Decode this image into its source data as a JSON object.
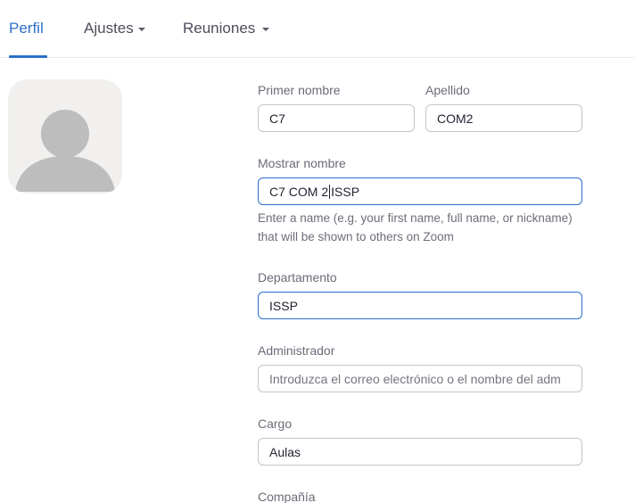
{
  "tabs": [
    {
      "label": "Perfil",
      "active": true
    },
    {
      "label": "Ajustes",
      "dropdown": true
    },
    {
      "label": "Reuniones",
      "dropdown": true
    }
  ],
  "avatar": {
    "icon": "user-placeholder-icon"
  },
  "form": {
    "first_name": {
      "label": "Primer nombre",
      "value": "C7"
    },
    "last_name": {
      "label": "Apellido",
      "value": "COM2"
    },
    "display_name": {
      "label": "Mostrar nombre",
      "value_before_cursor": "C7 COM 2",
      "value_after_cursor": "ISSP",
      "help": "Enter a name (e.g. your first name, full name, or nickname) that will be shown to others on Zoom"
    },
    "department": {
      "label": "Departamento",
      "value": "ISSP"
    },
    "manager": {
      "label": "Administrador",
      "placeholder": "Introduzca el correo electrónico o el nombre del adm"
    },
    "job_title": {
      "label": "Cargo",
      "value": "Aulas"
    },
    "company": {
      "label": "Compañía"
    }
  },
  "colors": {
    "accent": "#2d6fcb",
    "border": "#c4c4cc",
    "text": "#232333"
  }
}
